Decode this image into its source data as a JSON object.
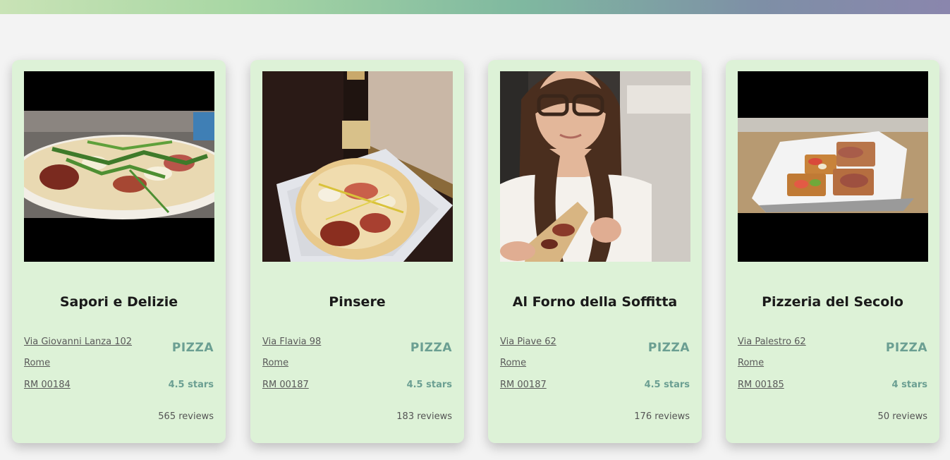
{
  "restaurants": [
    {
      "name": "Sapori e Delizie",
      "street": "Via Giovanni Lanza 102",
      "city": "Rome",
      "zip": "RM 00184",
      "category": "PIZZA",
      "rating": "4.5 stars",
      "reviews": "565 reviews",
      "photo": "pizza-with-arugula-photo"
    },
    {
      "name": "Pinsere",
      "street": "Via Flavia 98",
      "city": "Rome",
      "zip": "RM 00187",
      "category": "PIZZA",
      "rating": "4.5 stars",
      "reviews": "183 reviews",
      "photo": "pinsa-with-beer-photo"
    },
    {
      "name": "Al Forno della Soffitta",
      "street": "Via Piave 62",
      "city": "Rome",
      "zip": "RM 00187",
      "category": "PIZZA",
      "rating": "4.5 stars",
      "reviews": "176 reviews",
      "photo": "woman-eating-pizza-photo"
    },
    {
      "name": "Pizzeria del Secolo",
      "street": "Via Palestro 62",
      "city": "Rome",
      "zip": "RM 00185",
      "category": "PIZZA",
      "rating": "4 stars",
      "reviews": "50 reviews",
      "photo": "pizza-slices-on-paper-photo"
    }
  ],
  "colors": {
    "card_background": "#ddf2d7",
    "accent": "#6b9f92",
    "page_background": "#f3f3f3"
  }
}
